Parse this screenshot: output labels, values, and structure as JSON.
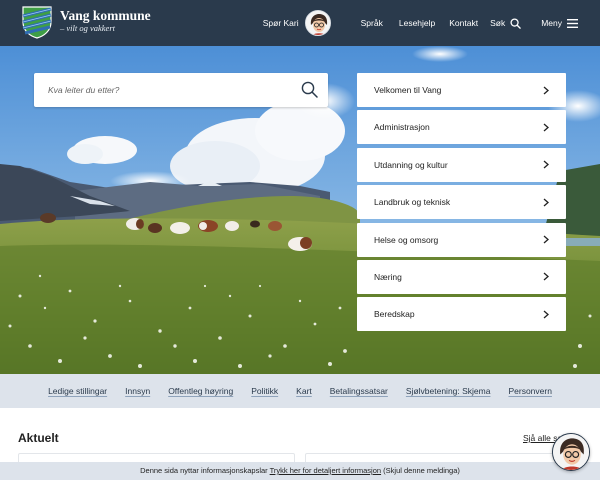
{
  "header": {
    "brand_name": "Vang kommune",
    "brand_tagline": "– vilt og vakkert",
    "nav": {
      "spor_kari": "Spør Kari",
      "sprak": "Språk",
      "lesehjelp": "Lesehjelp",
      "kontakt": "Kontakt",
      "sok": "Søk",
      "meny": "Meny"
    }
  },
  "search": {
    "placeholder": "Kva leiter du etter?",
    "value": ""
  },
  "menu": {
    "items": [
      {
        "label": "Velkomen til Vang"
      },
      {
        "label": "Administrasjon"
      },
      {
        "label": "Utdanning og kultur"
      },
      {
        "label": "Landbruk og teknisk"
      },
      {
        "label": "Helse og omsorg"
      },
      {
        "label": "Næring"
      },
      {
        "label": "Beredskap"
      }
    ]
  },
  "quick_links": [
    "Ledige stillingar",
    "Innsyn",
    "Offentleg høyring",
    "Politikk",
    "Kart",
    "Betalingssatsar",
    "Sjølvbetening: Skjema",
    "Personvern"
  ],
  "aktuelt": {
    "title": "Aktuelt",
    "see_all": "Sjå alle saker"
  },
  "cookie": {
    "text_before": "Denne sida nyttar informasjonskapslar",
    "link": "Trykk her for detaljert informasjon",
    "text_after": "(Skjul denne meldinga)"
  },
  "colors": {
    "header_bg": "#2a3a4c",
    "quick_bar_bg": "#dde3eb",
    "logo_green": "#3f9e46",
    "logo_blue": "#2f6db3"
  },
  "icons": {
    "logo": "coat-of-arms-icon",
    "search": "search-icon",
    "menu": "hamburger-icon",
    "chevron": "chevron-right-icon",
    "assistant": "avatar-icon"
  }
}
